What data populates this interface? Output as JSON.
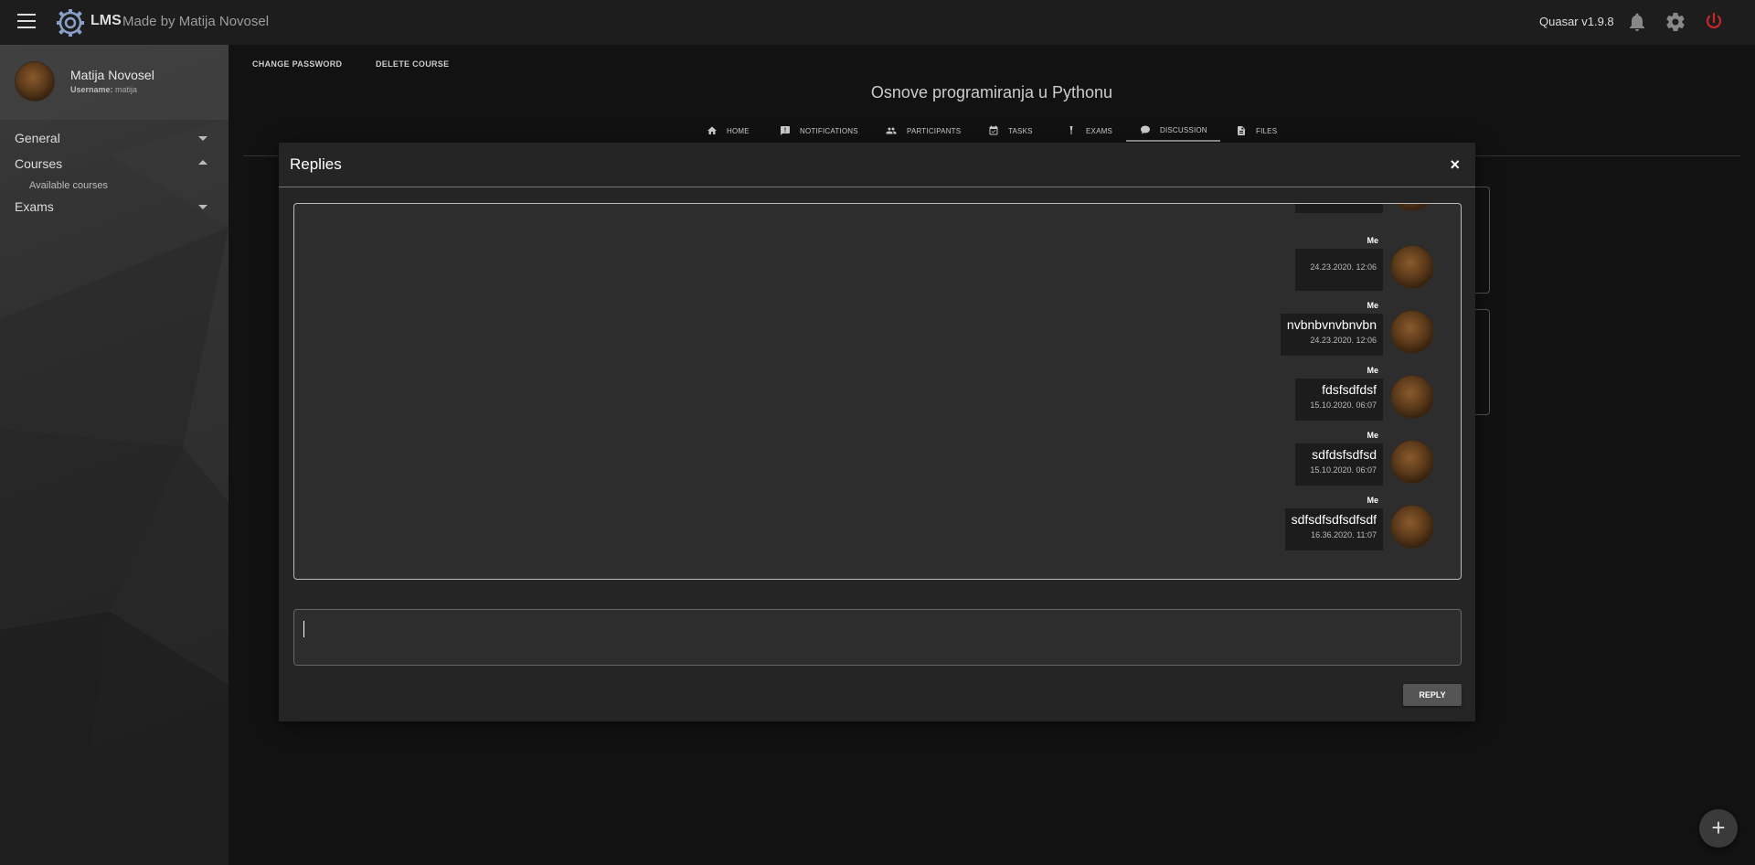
{
  "header": {
    "app_name": "LMS",
    "subtitle": "Made by Matija Novosel",
    "version": "Quasar v1.9.8"
  },
  "sidebar": {
    "user_name": "Matija Novosel",
    "username_label": "Username:",
    "username": "matija",
    "items": [
      {
        "label": "General",
        "state": "collapsed"
      },
      {
        "label": "Courses",
        "state": "expanded"
      },
      {
        "label": "Exams",
        "state": "collapsed"
      }
    ],
    "sub_items": [
      "Available courses"
    ]
  },
  "main": {
    "buttons": [
      "CHANGE PASSWORD",
      "DELETE COURSE"
    ],
    "course_title": "Osnove programiranja u Pythonu",
    "tabs": [
      {
        "label": "HOME",
        "icon": "home-icon"
      },
      {
        "label": "NOTIFICATIONS",
        "icon": "notification-icon"
      },
      {
        "label": "PARTICIPANTS",
        "icon": "people-icon"
      },
      {
        "label": "TASKS",
        "icon": "calendar-check-icon"
      },
      {
        "label": "EXAMS",
        "icon": "test-tube-icon"
      },
      {
        "label": "DISCUSSION",
        "icon": "chat-icon",
        "active": true
      },
      {
        "label": "FILES",
        "icon": "file-icon"
      }
    ]
  },
  "modal": {
    "title": "Replies",
    "close": "×",
    "messages": [
      {
        "sender": "Me",
        "text": "",
        "time": "24.23.2020. 12:06"
      },
      {
        "sender": "Me",
        "text": "nvbnbvnvbnvbn",
        "time": "24.23.2020. 12:06"
      },
      {
        "sender": "Me",
        "text": "fdsfsdfdsf",
        "time": "15.10.2020. 06:07"
      },
      {
        "sender": "Me",
        "text": "sdfdsfsdfsd",
        "time": "15.10.2020. 06:07"
      },
      {
        "sender": "Me",
        "text": "sdfsdfsdfsdfsdf",
        "time": "16.36.2020. 11:07"
      }
    ],
    "input_value": "",
    "reply_label": "REPLY"
  },
  "fab_label": "+",
  "colors": {
    "background": "#121212",
    "header": "#1d1d1d",
    "modal": "#252525",
    "power_icon": "#c62828"
  }
}
